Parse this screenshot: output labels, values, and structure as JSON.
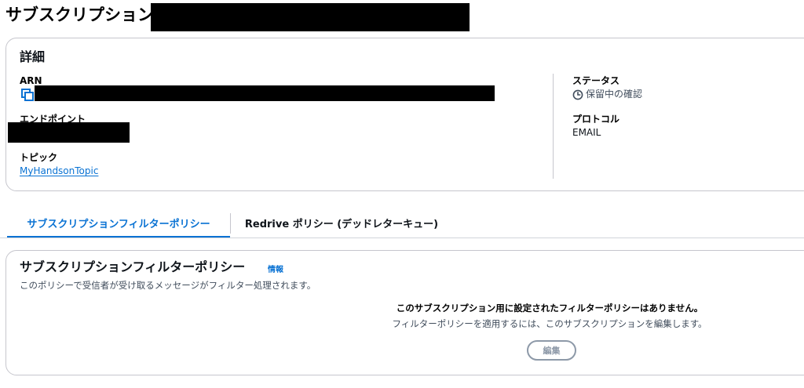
{
  "page": {
    "title": "サブスクリプション"
  },
  "details": {
    "heading": "詳細",
    "arn_label": "ARN",
    "endpoint_label": "エンドポイント",
    "topic_label": "トピック",
    "topic_value": "MyHandsonTopic",
    "status_label": "ステータス",
    "status_value": "保留中の確認",
    "protocol_label": "プロトコル",
    "protocol_value": "EMAIL"
  },
  "tabs": [
    {
      "label": "サブスクリプションフィルターポリシー",
      "active": true
    },
    {
      "label": "Redrive ポリシー (デッドレターキュー)",
      "active": false
    }
  ],
  "filter_policy": {
    "heading": "サブスクリプションフィルターポリシー",
    "info_link": "情報",
    "description": "このポリシーで受信者が受け取るメッセージがフィルター処理されます。",
    "empty_title": "このサブスクリプション用に設定されたフィルターポリシーはありません。",
    "empty_description": "フィルターポリシーを適用するには、このサブスクリプションを編集します。",
    "edit_button": "編集"
  },
  "icons": {
    "copy": "copy-icon",
    "status": "clock-icon"
  },
  "colors": {
    "accent": "#0972d3",
    "border": "#c6c6cd",
    "text": "#0f141a",
    "muted": "#414d5c",
    "disabled": "#8d99a8"
  }
}
